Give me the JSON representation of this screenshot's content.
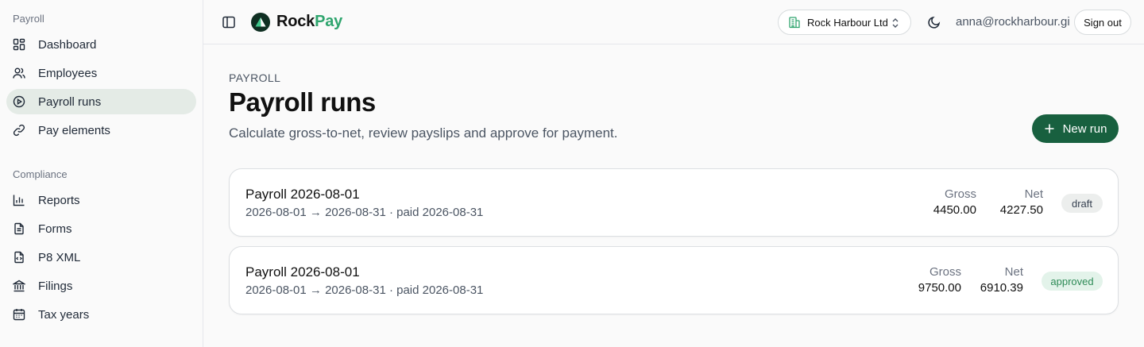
{
  "sidebar": {
    "sections": [
      {
        "label": "Payroll",
        "items": [
          {
            "label": "Dashboard",
            "icon": "dashboard-icon"
          },
          {
            "label": "Employees",
            "icon": "users-icon"
          },
          {
            "label": "Payroll runs",
            "icon": "play-circle-icon",
            "active": true
          },
          {
            "label": "Pay elements",
            "icon": "link-icon"
          }
        ]
      },
      {
        "label": "Compliance",
        "items": [
          {
            "label": "Reports",
            "icon": "bar-chart-icon"
          },
          {
            "label": "Forms",
            "icon": "document-icon"
          },
          {
            "label": "P8 XML",
            "icon": "code-file-icon"
          },
          {
            "label": "Filings",
            "icon": "bank-icon"
          },
          {
            "label": "Tax years",
            "icon": "calendar-icon"
          }
        ]
      }
    ]
  },
  "header": {
    "brand_part1": "Rock",
    "brand_part2": "Pay",
    "org_name": "Rock Harbour Ltd",
    "user_email": "anna@rockharbour.gi",
    "signout_label": "Sign out"
  },
  "main": {
    "eyebrow": "PAYROLL",
    "title": "Payroll runs",
    "subtitle": "Calculate gross-to-net, review payslips and approve for payment.",
    "new_run_label": "New run",
    "runs": [
      {
        "title": "Payroll 2026-08-01",
        "dates": "2026-08-01 → 2026-08-31 · paid 2026-08-31",
        "gross_label": "Gross",
        "gross": "4450.00",
        "net_label": "Net",
        "net": "4227.50",
        "status": "draft"
      },
      {
        "title": "Payroll 2026-08-01",
        "dates": "2026-08-01 → 2026-08-31 · paid 2026-08-31",
        "gross_label": "Gross",
        "gross": "9750.00",
        "net_label": "Net",
        "net": "6910.39",
        "status": "approved"
      }
    ]
  },
  "colors": {
    "brand_green": "#2fa56e",
    "primary_button": "#18603f",
    "active_nav": "#e4ebe6"
  }
}
